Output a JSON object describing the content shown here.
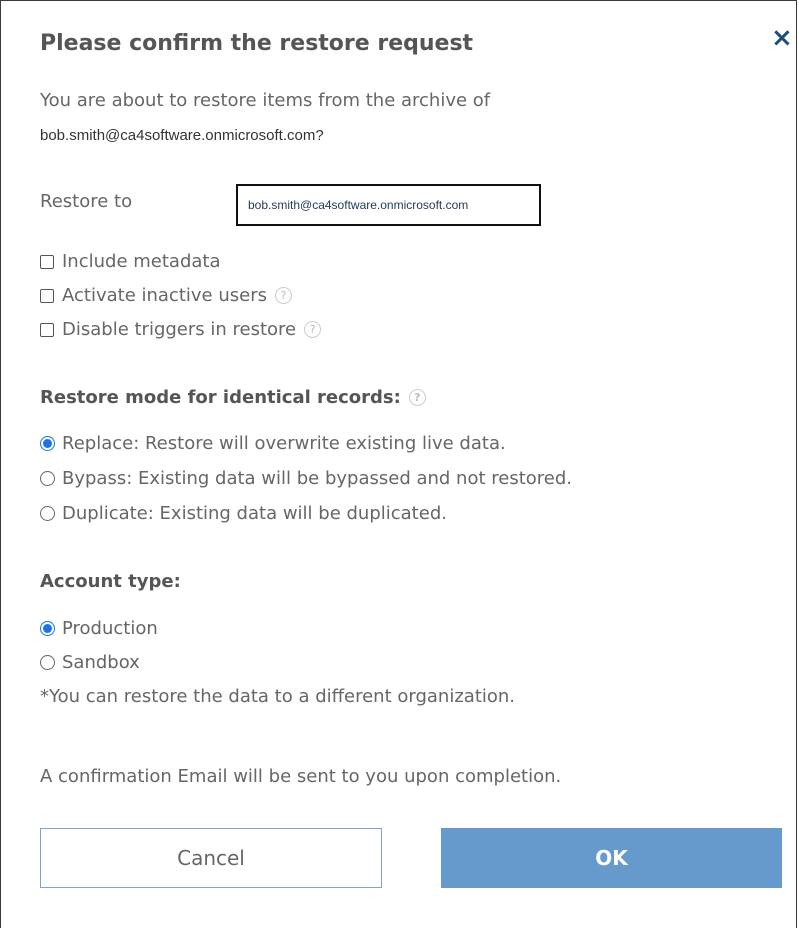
{
  "dialog": {
    "title": "Please confirm the restore request",
    "close_icon": "×",
    "intro": "You are about to restore items from the archive of",
    "account": "bob.smith@ca4software.onmicrosoft.com?",
    "restore_to_label": "Restore to",
    "restore_to_value": "bob.smith@ca4software.onmicrosoft.com",
    "options": [
      {
        "label": "Include metadata",
        "checked": false
      },
      {
        "label": "Activate inactive users",
        "checked": false
      },
      {
        "label": "Disable triggers in restore",
        "checked": false
      }
    ],
    "restore_mode": {
      "heading": "Restore mode for identical records:",
      "items": [
        {
          "label": "Replace: Restore will overwrite existing live data.",
          "selected": true
        },
        {
          "label": "Bypass: Existing data will be bypassed and not restored.",
          "selected": false
        },
        {
          "label": "Duplicate: Existing data will be duplicated.",
          "selected": false
        }
      ]
    },
    "account_type": {
      "heading": "Account type:",
      "items": [
        {
          "label": "Production",
          "selected": true
        },
        {
          "label": "Sandbox",
          "selected": false
        }
      ],
      "note": "*You can restore the data to a different organization."
    },
    "confirmation": "A confirmation Email will be sent to you upon completion.",
    "help_glyph": "?",
    "buttons": {
      "cancel": "Cancel",
      "ok": "OK"
    },
    "colors": {
      "accent": "#1a73e8",
      "ok_button": "#6699cc",
      "close_icon": "#1f4e79"
    }
  }
}
